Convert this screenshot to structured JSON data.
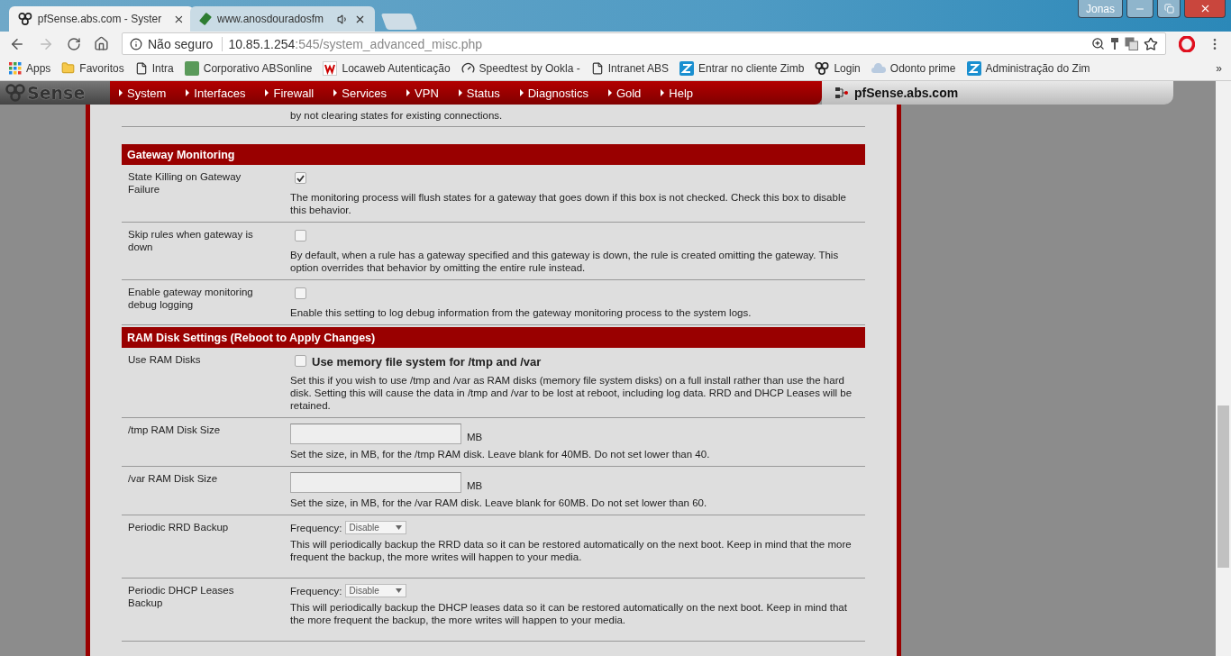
{
  "browser": {
    "tabs": [
      {
        "title": "pfSense.abs.com - Syster",
        "selected": true,
        "audio": false
      },
      {
        "title": "www.anosdouradosfm",
        "selected": false,
        "audio": true
      }
    ],
    "user": "Jonas",
    "address": {
      "security": "Não seguro",
      "host": "10.85.1.254",
      "path": ":545/system_advanced_misc.php"
    },
    "bookmarks": [
      {
        "kind": "apps",
        "title": "Apps"
      },
      {
        "kind": "folder",
        "title": "Favoritos"
      },
      {
        "kind": "page",
        "title": "Intra"
      },
      {
        "kind": "abs",
        "title": "Corporativo ABSonline"
      },
      {
        "kind": "w",
        "title": "Locaweb Autenticação"
      },
      {
        "kind": "gauge",
        "title": "Speedtest by Ookla -"
      },
      {
        "kind": "page",
        "title": "Intranet ABS"
      },
      {
        "kind": "z",
        "title": "Entrar no cliente Zimb"
      },
      {
        "kind": "rings",
        "title": "Login"
      },
      {
        "kind": "cloud",
        "title": "Odonto prime"
      },
      {
        "kind": "z",
        "title": "Administração do Zim"
      }
    ],
    "overflow": "»"
  },
  "app": {
    "logo": "Sense",
    "menu": [
      "System",
      "Interfaces",
      "Firewall",
      "Services",
      "VPN",
      "Status",
      "Diagnostics",
      "Gold",
      "Help"
    ],
    "hostname": "pfSense.abs.com"
  },
  "intro_text": "by not clearing states for existing connections.",
  "sections": [
    {
      "title": "Gateway Monitoring",
      "rows": [
        {
          "kind": "checkbox",
          "label": "State Killing on Gateway Failure",
          "checked": true,
          "description": "The monitoring process will flush states for a gateway that goes down if this box is not checked. Check this box to disable this behavior."
        },
        {
          "kind": "checkbox",
          "label": "Skip rules when gateway is down",
          "checked": false,
          "description": "By default, when a rule has a gateway specified and this gateway is down, the rule is created omitting the gateway. This option overrides that behavior by omitting the entire rule instead."
        },
        {
          "kind": "checkbox",
          "label": "Enable gateway monitoring debug logging",
          "checked": false,
          "description": "Enable this setting to log debug information from the gateway monitoring process to the system logs."
        }
      ]
    },
    {
      "title": "RAM Disk Settings (Reboot to Apply Changes)",
      "rows": [
        {
          "kind": "checkbox",
          "label": "Use RAM Disks",
          "checked": false,
          "option": "Use memory file system for /tmp and /var",
          "description": "Set this if you wish to use /tmp and /var as RAM disks (memory file system disks) on a full install rather than use the hard disk. Setting this will cause the data in /tmp and /var to be lost at reboot, including log data. RRD and DHCP Leases will be retained."
        },
        {
          "kind": "number",
          "label": "/tmp RAM Disk Size",
          "unit": "MB",
          "description": "Set the size, in MB, for the /tmp RAM disk. Leave blank for 40MB. Do not set lower than 40."
        },
        {
          "kind": "number",
          "label": "/var RAM Disk Size",
          "unit": "MB",
          "description": "Set the size, in MB, for the /var RAM disk. Leave blank for 60MB. Do not set lower than 60."
        },
        {
          "kind": "select",
          "label": "Periodic RRD Backup",
          "prefix": "Frequency:",
          "value": "Disable",
          "description": "This will periodically backup the RRD data so it can be restored automatically on the next boot. Keep in mind that the more frequent the backup, the more writes will happen to your media."
        },
        {
          "kind": "select",
          "label": "Periodic DHCP Leases Backup",
          "prefix": "Frequency:",
          "value": "Disable",
          "description": "This will periodically backup the DHCP leases data so it can be restored automatically on the next boot. Keep in mind that the more frequent the backup, the more writes will happen to your media."
        }
      ]
    }
  ]
}
